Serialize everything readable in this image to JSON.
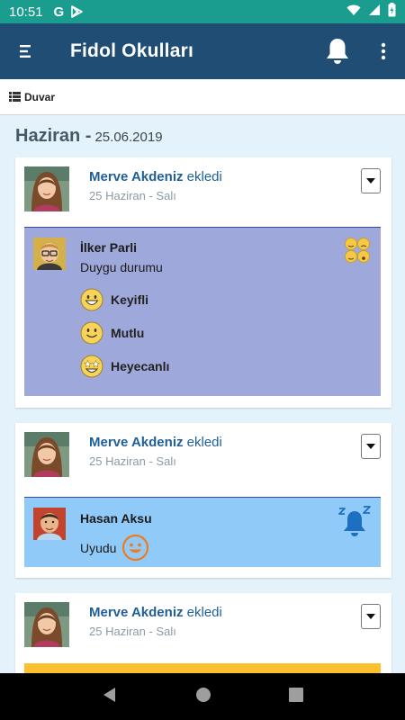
{
  "status_bar": {
    "time": "10:51",
    "g_icon": "G",
    "icons": [
      "google-icon",
      "play-store-icon",
      "wifi-icon",
      "signal-icon",
      "battery-icon"
    ]
  },
  "app_bar": {
    "title": "Fidol Okulları"
  },
  "sub_bar": {
    "label": "Duvar"
  },
  "section": {
    "month": "Haziran -",
    "date": "25.06.2019"
  },
  "posts": [
    {
      "author": "Merve Akdeniz",
      "action": "ekledi",
      "date": "25 Haziran - Salı",
      "child": "İlker Parli",
      "title": "Duygu durumu",
      "moods": [
        "Keyifli",
        "Mutlu",
        "Heyecanlı"
      ],
      "panel_color": "#9fa8da"
    },
    {
      "author": "Merve Akdeniz",
      "action": "ekledi",
      "date": "25 Haziran - Salı",
      "child": "Hasan Aksu",
      "text": "Uyudu",
      "panel_color": "#90caf9"
    },
    {
      "author": "Merve Akdeniz",
      "action": "ekledi",
      "date": "25 Haziran - Salı",
      "panel_color": "#fbc02d"
    }
  ],
  "colors": {
    "status": "#1a9d8f",
    "app_bar": "#1f4d74",
    "author": "#1f5f99",
    "background": "#e4f3fb"
  }
}
